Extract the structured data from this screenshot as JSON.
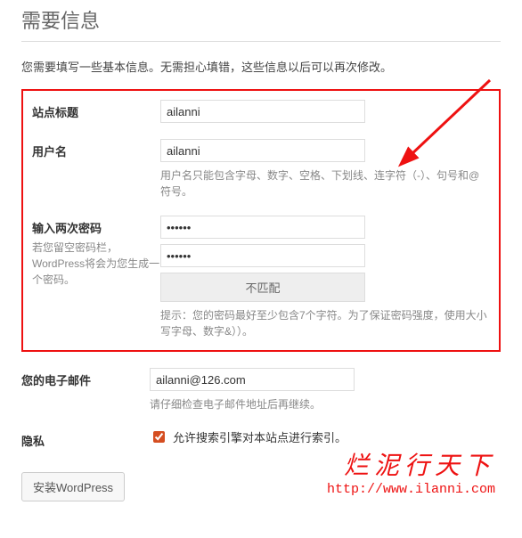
{
  "page_title": "需要信息",
  "intro": "您需要填写一些基本信息。无需担心填错，这些信息以后可以再次修改。",
  "fields": {
    "site_title": {
      "label": "站点标题",
      "value": "ailanni"
    },
    "username": {
      "label": "用户名",
      "value": "ailanni",
      "hint": "用户名只能包含字母、数字、空格、下划线、连字符（-）、句号和@符号。"
    },
    "password": {
      "label": "输入两次密码",
      "desc": "若您留空密码栏，WordPress将会为您生成一个密码。",
      "value1": "••••••",
      "value2": "••••••",
      "mismatch": "不匹配",
      "hint": "提示：您的密码最好至少包含7个字符。为了保证密码强度，使用大小写字母、数字&））。"
    },
    "email": {
      "label": "您的电子邮件",
      "value": "ailanni@126.com",
      "hint": "请仔细检查电子邮件地址后再继续。"
    },
    "privacy": {
      "label": "隐私",
      "checkbox_label": "允许搜索引擎对本站点进行索引。",
      "checked": true
    }
  },
  "install_button": "安装WordPress",
  "watermark": {
    "cn": "烂泥行天下",
    "url": "http://www.ilanni.com"
  }
}
